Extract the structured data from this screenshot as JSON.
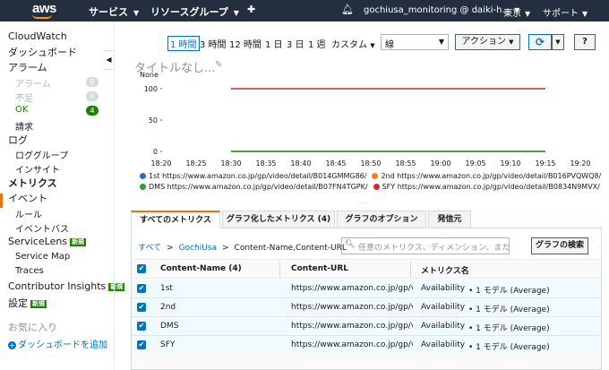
{
  "topnav": {
    "logo": "aws",
    "services": "サービス",
    "resource_groups": "リソースグループ",
    "account": "gochiusa_monitoring @ daiki-h...",
    "region": "東京",
    "support": "サポート"
  },
  "sidebar": {
    "cloudwatch": "CloudWatch",
    "dashboards": "ダッシュボード",
    "alarms": "アラーム",
    "alarm_alarm": "アラーム",
    "alarm_alarm_count": "0",
    "alarm_insufficient": "不足",
    "alarm_insufficient_count": "0",
    "alarm_ok": "OK",
    "alarm_ok_count": "4",
    "billing": "請求",
    "logs": "ログ",
    "log_groups": "ロググループ",
    "insights": "インサイト",
    "metrics": "メトリクス",
    "events": "イベント",
    "rules": "ルール",
    "event_buses": "イベントバス",
    "servicelens": "ServiceLens",
    "new_tag": "新規",
    "service_map": "Service Map",
    "traces": "Traces",
    "contributor_insights": "Contributor Insights",
    "settings": "設定",
    "favorites": "お気に入り",
    "add_dashboard": "ダッシュボードを追加"
  },
  "toolbar": {
    "ranges": [
      "1 時間",
      "3 時間",
      "12 時間",
      "1 日",
      "3 日",
      "1 週",
      "カスタム"
    ],
    "active_range": "1 時間",
    "chart_type": "線",
    "actions": "アクション"
  },
  "chart": {
    "title_placeholder": "タイトルなし...",
    "unit": "None"
  },
  "chart_data": {
    "type": "line",
    "ylim": [
      0,
      100
    ],
    "y_ticks": [
      "100",
      "50",
      "0"
    ],
    "x_ticks": [
      "18:20",
      "18:25",
      "18:30",
      "18:35",
      "18:40",
      "18:45",
      "18:50",
      "18:55",
      "19:00",
      "19:05",
      "19:10",
      "19:15",
      "19:20"
    ],
    "x": [
      "18:30",
      "19:15"
    ],
    "series": [
      {
        "name": "1st https://www.amazon.co.jp/gp/video/detail/B014GMMG86/",
        "color": "#1f77b4",
        "values": [
          0,
          0
        ]
      },
      {
        "name": "2nd https://www.amazon.co.jp/gp/video/detail/B016PVQWQ8/",
        "color": "#ff7f0e",
        "values": [
          0,
          0
        ]
      },
      {
        "name": "DMS https://www.amazon.co.jp/gp/video/detail/B07FN4TGPK/",
        "color": "#2ca02c",
        "values": [
          0,
          0
        ]
      },
      {
        "name": "SFY https://www.amazon.co.jp/gp/video/detail/B0834N9MVX/",
        "color": "#d62728",
        "values": [
          100,
          100
        ]
      }
    ]
  },
  "tabs": [
    {
      "label": "すべてのメトリクス"
    },
    {
      "label": "グラフ化したメトリクス (4)"
    },
    {
      "label": "グラフのオプション"
    },
    {
      "label": "発信元"
    }
  ],
  "browse": {
    "crumb_all": "すべて",
    "crumb_namespace": "GochiUsa",
    "crumb_dimension": "Content-Name,Content-URL",
    "search_placeholder": "任意のメトリクス、ディメンション、または",
    "search_button": "グラフの検索"
  },
  "table": {
    "headers": [
      "Content-Name (4)",
      "Content-URL",
      "メトリクス名"
    ],
    "rows": [
      {
        "name": "1st",
        "url": "https://www.amazon.co.jp/gp/videc",
        "metric": "Availability",
        "model": "• 1 モデル (Average)"
      },
      {
        "name": "2nd",
        "url": "https://www.amazon.co.jp/gp/videc",
        "metric": "Availability",
        "model": "• 1 モデル (Average)"
      },
      {
        "name": "DMS",
        "url": "https://www.amazon.co.jp/gp/videc",
        "metric": "Availability",
        "model": "• 1 モデル (Average)"
      },
      {
        "name": "SFY",
        "url": "https://www.amazon.co.jp/gp/videc",
        "metric": "Availability",
        "model": "• 1 モデル (Average)"
      }
    ]
  }
}
